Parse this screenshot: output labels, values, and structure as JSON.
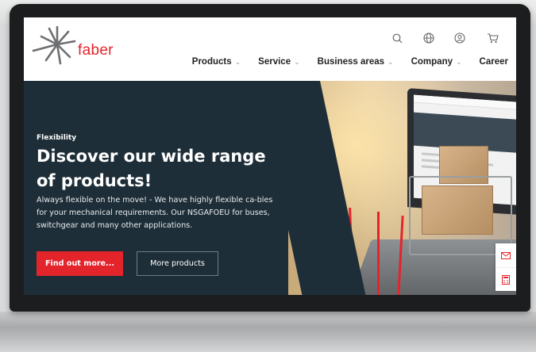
{
  "brand": {
    "name": "faber",
    "accent": "#e4242b",
    "hero_bg": "#1e2e38"
  },
  "header": {
    "icons": [
      "search-icon",
      "globe-icon",
      "user-icon",
      "cart-icon"
    ],
    "nav": [
      {
        "label": "Products",
        "dropdown": true
      },
      {
        "label": "Service",
        "dropdown": true
      },
      {
        "label": "Business areas",
        "dropdown": true
      },
      {
        "label": "Company",
        "dropdown": true
      },
      {
        "label": "Career",
        "dropdown": false
      }
    ]
  },
  "hero": {
    "eyebrow": "Flexibility",
    "headline": "Discover our wide range of products!",
    "body": "Always flexible on the move! - We have highly flexible ca-bles for your mechanical requirements. Our NSGAFOEU for buses, switchgear and many other applications.",
    "cta_primary": "Find out more...",
    "cta_secondary": "More products"
  },
  "side_tabs": [
    "mail-icon",
    "calculator-icon"
  ]
}
